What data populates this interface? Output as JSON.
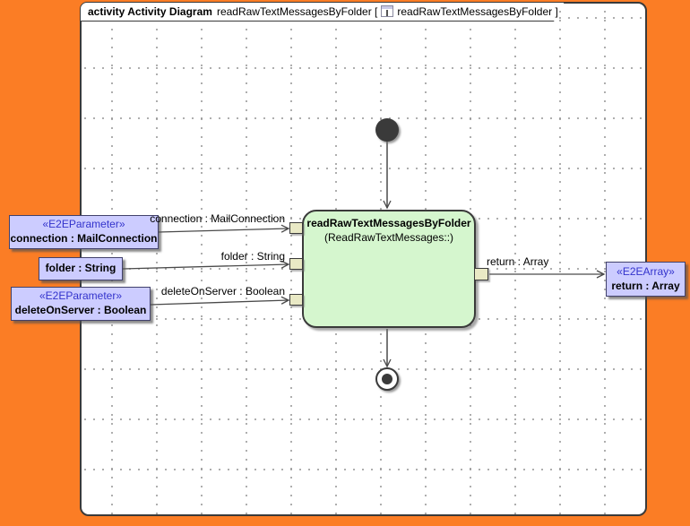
{
  "tab": {
    "keyword": "activity Activity Diagram",
    "diagram_name": "readRawTextMessagesByFolder [",
    "ref_name": "readRawTextMessagesByFolder ]"
  },
  "activity_node": {
    "title": "readRawTextMessagesByFolder",
    "qualifier": "(ReadRawTextMessages::)"
  },
  "parameters": [
    {
      "stereotype": "«E2EParameter»",
      "name": "connection : MailConnection"
    },
    {
      "name": "folder : String"
    },
    {
      "stereotype": "«E2EParameter»",
      "name": "deleteOnServer : Boolean"
    },
    {
      "stereotype": "«E2EArray»",
      "name": "return : Array"
    }
  ],
  "edge_labels": {
    "connection": "connection : MailConnection",
    "folder": "folder : String",
    "deleteOnServer": "deleteOnServer : Boolean",
    "return": "return : Array"
  },
  "colors": {
    "frame-orange": "#fb7d25",
    "canvas-white": "#ffffff",
    "grid-dot": "#9a9a9a",
    "node-green": "#d5f6ce",
    "node-border": "#3a3a3a",
    "param-lavender": "#ccccff",
    "param-border": "#41416b",
    "stereotype-blue": "#3333cc",
    "pin-beige": "#e9e9c5",
    "edge-gray": "#4a4a4a"
  }
}
